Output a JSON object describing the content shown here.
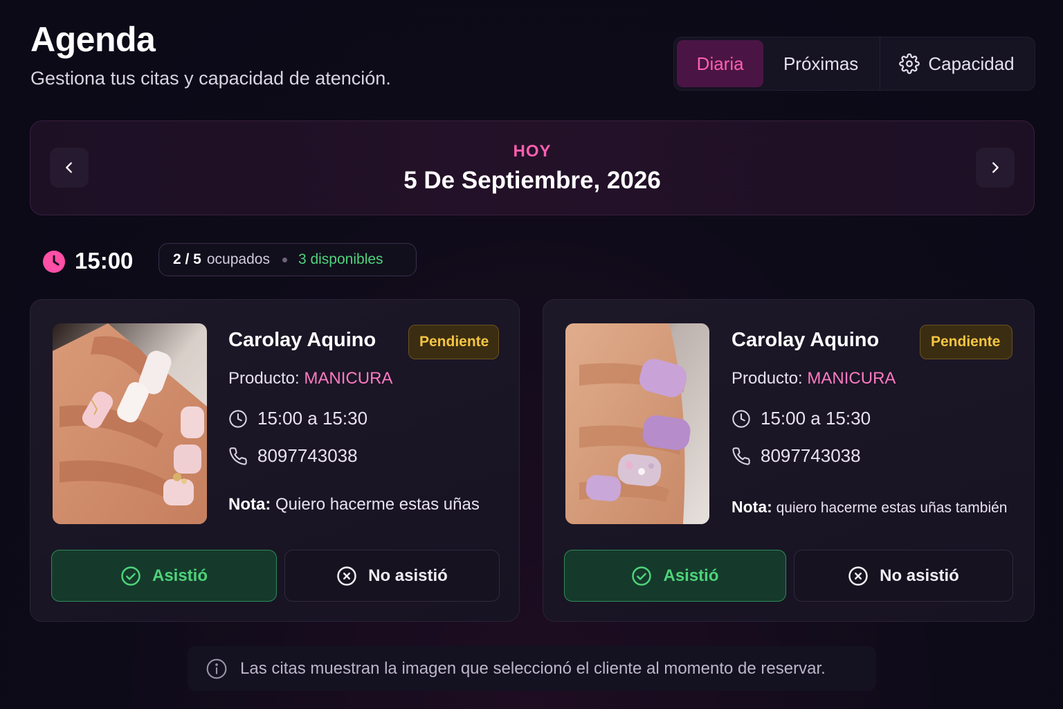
{
  "header": {
    "title": "Agenda",
    "subtitle": "Gestiona tus citas y capacidad de atención."
  },
  "view_tabs": {
    "active": "Diaria",
    "items": [
      {
        "label": "Diaria",
        "icon": null
      },
      {
        "label": "Próximas",
        "icon": null
      },
      {
        "label": "Capacidad",
        "icon": "gear-icon"
      }
    ]
  },
  "date_nav": {
    "label": "HOY",
    "date": "5 De Septiembre, 2026",
    "prev_icon": "chevron-left-icon",
    "next_icon": "chevron-right-icon"
  },
  "slot": {
    "time": "15:00",
    "occupied": "2 / 5",
    "occupied_label": "ocupados",
    "available": "3 disponibles"
  },
  "appointments": [
    {
      "client": "Carolay Aquino",
      "status": "Pendiente",
      "product_label": "Producto:",
      "product": "MANICURA",
      "time_range": "15:00 a 15:30",
      "phone": "8097743038",
      "note_label": "Nota:",
      "note": "Quiero hacerme estas uñas",
      "attended_label": "Asistió",
      "absent_label": "No asistió"
    },
    {
      "client": "Carolay Aquino",
      "status": "Pendiente",
      "product_label": "Producto:",
      "product": "MANICURA",
      "time_range": "15:00 a 15:30",
      "phone": "8097743038",
      "note_label": "Nota:",
      "note": "quiero hacerme estas uñas también",
      "attended_label": "Asistió",
      "absent_label": "No asistió"
    }
  ],
  "footer": {
    "text": "Las citas muestran la imagen que seleccionó el cliente al momento de reservar.",
    "icon": "info-icon"
  },
  "colors": {
    "accent": "#ff5fb0",
    "success": "#4fd37a",
    "warning": "#f5c542",
    "background": "#0e0b19"
  }
}
